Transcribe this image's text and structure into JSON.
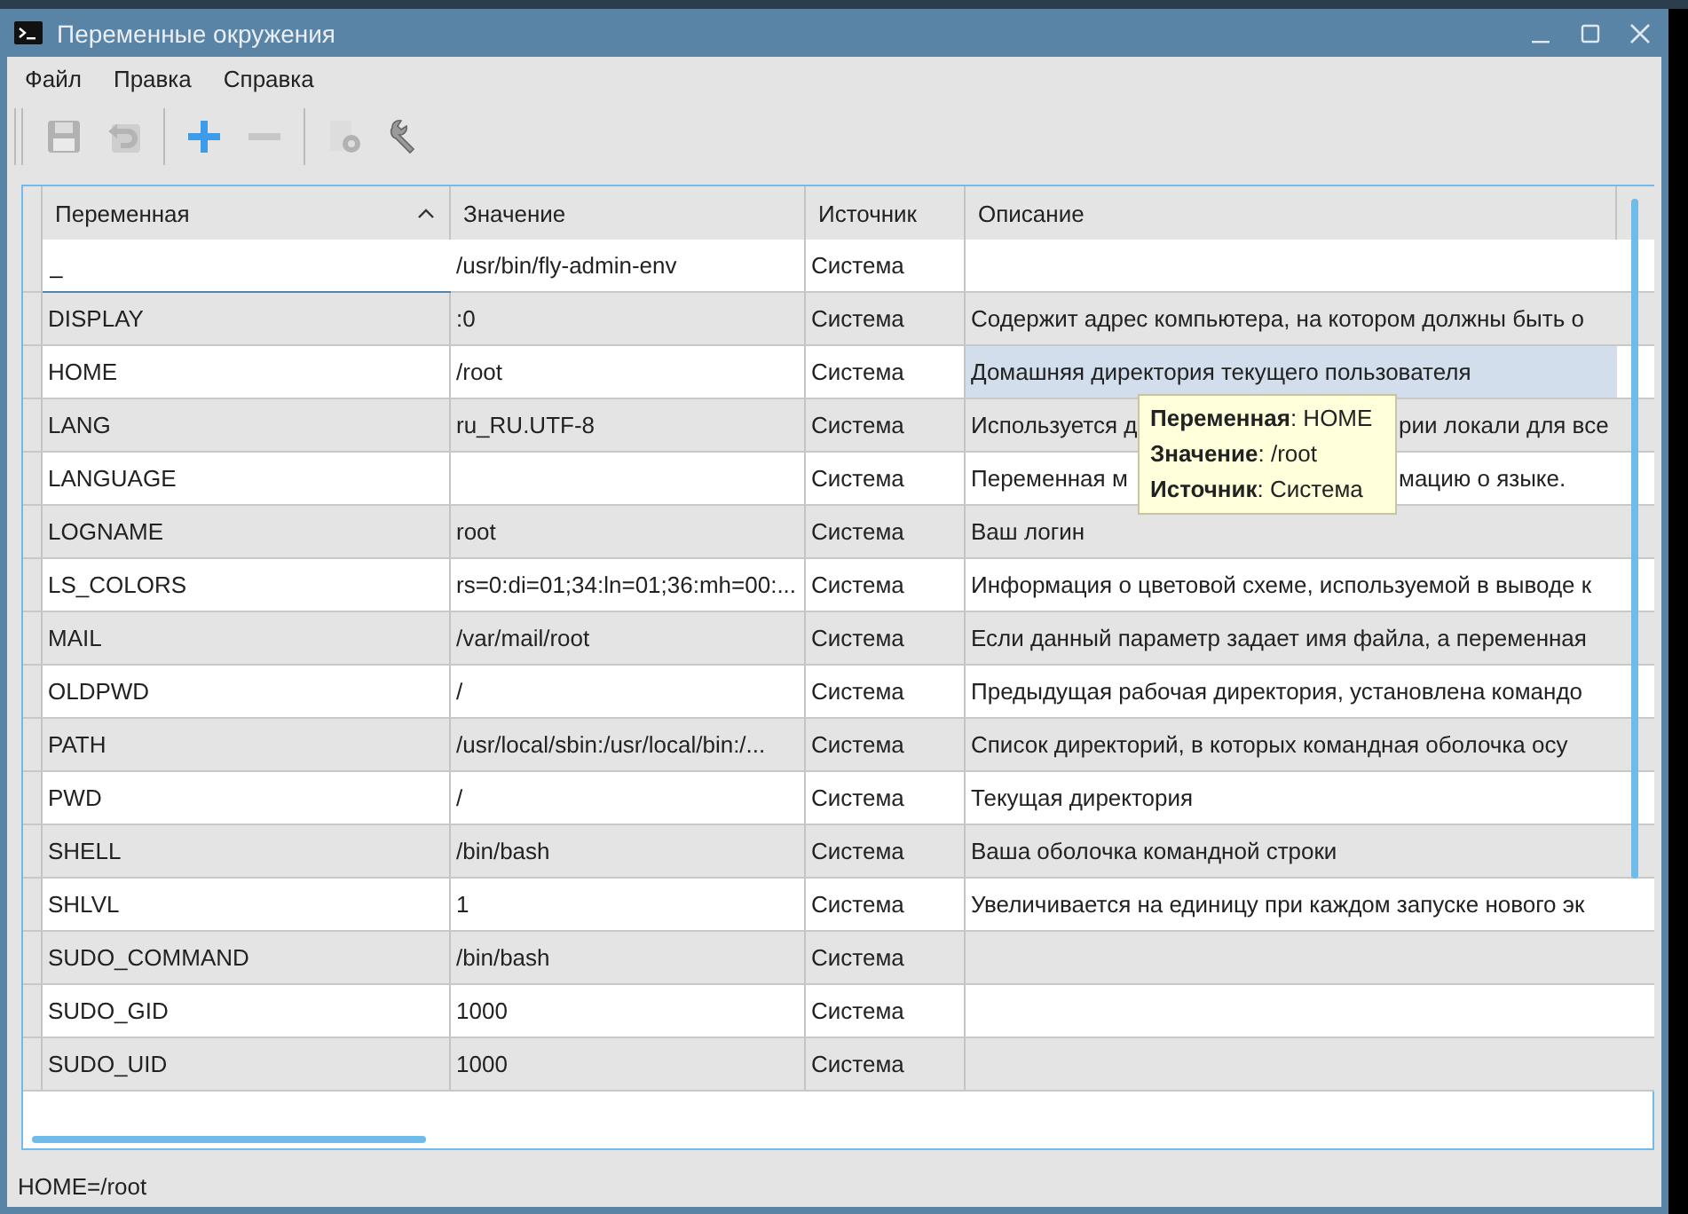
{
  "window": {
    "title": "Переменные окружения"
  },
  "menu": [
    "Файл",
    "Правка",
    "Справка"
  ],
  "toolbar": [
    {
      "disabled": true
    },
    {
      "disabled": true
    },
    {
      "disabled": false
    },
    {
      "disabled": true
    },
    {
      "disabled": true
    },
    {
      "disabled": false
    }
  ],
  "table": {
    "columns": [
      {
        "label": "Переменная",
        "sorted": true
      },
      {
        "label": "Значение",
        "sorted": false
      },
      {
        "label": "Источник",
        "sorted": false
      },
      {
        "label": "Описание",
        "sorted": false
      }
    ],
    "rows": [
      {
        "name": "_",
        "value": "/usr/bin/fly-admin-env",
        "source": "Система",
        "editing": true,
        "hovered": false
      },
      {
        "name": "DISPLAY",
        "value": ":0",
        "source": "Система",
        "description": "Содержит адрес компьютера, на котором должны быть о",
        "editing": false,
        "hovered": false
      },
      {
        "name": "HOME",
        "value": "/root",
        "source": "Система",
        "description": "Домашняя директория текущего пользователя",
        "editing": false,
        "hovered": true
      },
      {
        "name": "LANG",
        "value": "ru_RU.UTF-8",
        "source": "Система",
        "description": "Используется д",
        "description_after": "рии локали для все",
        "editing": false,
        "hovered": false
      },
      {
        "name": "LANGUAGE",
        "source": "Система",
        "description": "Переменная м",
        "description_after": "мацию о языке.",
        "editing": false,
        "hovered": false
      },
      {
        "name": "LOGNAME",
        "value": "root",
        "source": "Система",
        "description": "Ваш логин",
        "editing": false,
        "hovered": false
      },
      {
        "name": "LS_COLORS",
        "value": "rs=0:di=01;34:ln=01;36:mh=00:...",
        "source": "Система",
        "description": "Информация о цветовой схеме, используемой в выводе к",
        "editing": false,
        "hovered": false
      },
      {
        "name": "MAIL",
        "value": "/var/mail/root",
        "source": "Система",
        "description": "Если данный параметр задает имя файла, а переменная",
        "editing": false,
        "hovered": false
      },
      {
        "name": "OLDPWD",
        "value": "/",
        "source": "Система",
        "description": "Предыдущая рабочая директория, установлена командо",
        "editing": false,
        "hovered": false
      },
      {
        "name": "PATH",
        "value": "/usr/local/sbin:/usr/local/bin:/...",
        "source": "Система",
        "description": "Список директорий, в которых командная оболочка осу",
        "editing": false,
        "hovered": false
      },
      {
        "name": "PWD",
        "value": "/",
        "source": "Система",
        "description": "Текущая директория",
        "editing": false,
        "hovered": false
      },
      {
        "name": "SHELL",
        "value": "/bin/bash",
        "source": "Система",
        "description": "Ваша оболочка командной строки",
        "editing": false,
        "hovered": false
      },
      {
        "name": "SHLVL",
        "value": "1",
        "source": "Система",
        "description": "Увеличивается на единицу при каждом запуске нового эк",
        "editing": false,
        "hovered": false
      },
      {
        "name": "SUDO_COMMAND",
        "value": "/bin/bash",
        "source": "Система",
        "editing": false,
        "hovered": false
      },
      {
        "name": "SUDO_GID",
        "value": "1000",
        "source": "Система",
        "editing": false,
        "hovered": false
      },
      {
        "name": "SUDO_UID",
        "value": "1000",
        "source": "Система",
        "editing": false,
        "hovered": false
      }
    ]
  },
  "tooltip": [
    "**Переменная**: HOME",
    "**Значение**: /root",
    "**Источник**: Система"
  ],
  "status_bar": "HOME=/root"
}
